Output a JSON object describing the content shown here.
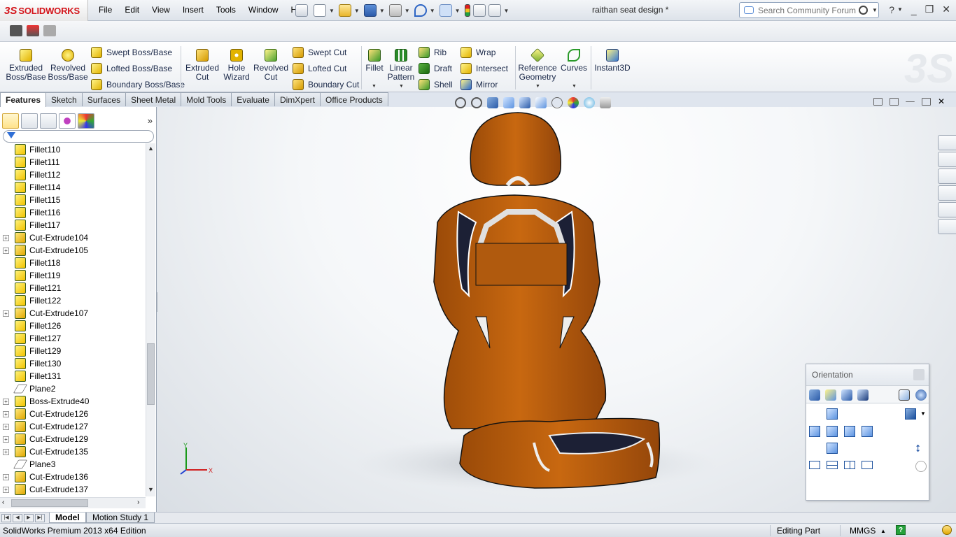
{
  "app": {
    "brand": "SOLIDWORKS",
    "document_title": "raithan seat design *"
  },
  "menu": [
    "File",
    "Edit",
    "View",
    "Insert",
    "Tools",
    "Window",
    "Help"
  ],
  "search": {
    "placeholder": "Search Community Forum"
  },
  "command_manager": {
    "big_buttons": [
      {
        "label": "Extruded Boss/Base",
        "icon": "extruded-boss-icon"
      },
      {
        "label": "Revolved Boss/Base",
        "icon": "revolved-boss-icon"
      },
      {
        "label": "Extruded Cut",
        "icon": "extruded-cut-icon"
      },
      {
        "label": "Hole Wizard",
        "icon": "hole-wizard-icon"
      },
      {
        "label": "Revolved Cut",
        "icon": "revolved-cut-icon"
      },
      {
        "label": "Fillet",
        "icon": "fillet-icon"
      },
      {
        "label": "Linear Pattern",
        "icon": "linear-pattern-icon"
      },
      {
        "label": "Reference Geometry",
        "icon": "reference-geometry-icon"
      },
      {
        "label": "Curves",
        "icon": "curves-icon"
      },
      {
        "label": "Instant3D",
        "icon": "instant3d-icon"
      }
    ],
    "small_buttons": [
      {
        "label": "Swept Boss/Base"
      },
      {
        "label": "Lofted Boss/Base"
      },
      {
        "label": "Boundary Boss/Base"
      },
      {
        "label": "Swept Cut"
      },
      {
        "label": "Lofted Cut"
      },
      {
        "label": "Boundary Cut"
      },
      {
        "label": "Rib"
      },
      {
        "label": "Draft"
      },
      {
        "label": "Shell"
      },
      {
        "label": "Wrap"
      },
      {
        "label": "Intersect"
      },
      {
        "label": "Mirror"
      }
    ]
  },
  "tabs": [
    "Features",
    "Sketch",
    "Surfaces",
    "Sheet Metal",
    "Mold Tools",
    "Evaluate",
    "DimXpert",
    "Office Products"
  ],
  "feature_tree": [
    {
      "label": "Fillet110",
      "type": "fillet",
      "expandable": false
    },
    {
      "label": "Fillet111",
      "type": "fillet",
      "expandable": false
    },
    {
      "label": "Fillet112",
      "type": "fillet",
      "expandable": false
    },
    {
      "label": "Fillet114",
      "type": "fillet",
      "expandable": false
    },
    {
      "label": "Fillet115",
      "type": "fillet",
      "expandable": false
    },
    {
      "label": "Fillet116",
      "type": "fillet",
      "expandable": false
    },
    {
      "label": "Fillet117",
      "type": "fillet",
      "expandable": false
    },
    {
      "label": "Cut-Extrude104",
      "type": "cut",
      "expandable": true
    },
    {
      "label": "Cut-Extrude105",
      "type": "cut",
      "expandable": true
    },
    {
      "label": "Fillet118",
      "type": "fillet",
      "expandable": false
    },
    {
      "label": "Fillet119",
      "type": "fillet",
      "expandable": false
    },
    {
      "label": "Fillet121",
      "type": "fillet",
      "expandable": false
    },
    {
      "label": "Fillet122",
      "type": "fillet",
      "expandable": false
    },
    {
      "label": "Cut-Extrude107",
      "type": "cut",
      "expandable": true
    },
    {
      "label": "Fillet126",
      "type": "fillet",
      "expandable": false
    },
    {
      "label": "Fillet127",
      "type": "fillet",
      "expandable": false
    },
    {
      "label": "Fillet129",
      "type": "fillet",
      "expandable": false
    },
    {
      "label": "Fillet130",
      "type": "fillet",
      "expandable": false
    },
    {
      "label": "Fillet131",
      "type": "fillet",
      "expandable": false
    },
    {
      "label": "Plane2",
      "type": "plane",
      "expandable": false
    },
    {
      "label": "Boss-Extrude40",
      "type": "boss",
      "expandable": true
    },
    {
      "label": "Cut-Extrude126",
      "type": "cut",
      "expandable": true
    },
    {
      "label": "Cut-Extrude127",
      "type": "cut",
      "expandable": true
    },
    {
      "label": "Cut-Extrude129",
      "type": "cut",
      "expandable": true
    },
    {
      "label": "Cut-Extrude135",
      "type": "cut",
      "expandable": true
    },
    {
      "label": "Plane3",
      "type": "plane",
      "expandable": false
    },
    {
      "label": "Cut-Extrude136",
      "type": "cut",
      "expandable": true
    },
    {
      "label": "Cut-Extrude137",
      "type": "cut",
      "expandable": true
    }
  ],
  "orientation": {
    "title": "Orientation"
  },
  "axes": {
    "x": "X",
    "y": "Y"
  },
  "bottom_tabs": [
    "Model",
    "Motion Study 1"
  ],
  "status": {
    "edition": "SolidWorks Premium 2013 x64 Edition",
    "mode": "Editing Part",
    "units": "MMGS",
    "units_arrow": "▲",
    "help": "?"
  },
  "colors": {
    "accent_red": "#d4151b",
    "seat_orange": "#b85d0e",
    "seat_dark": "#1c2035"
  }
}
